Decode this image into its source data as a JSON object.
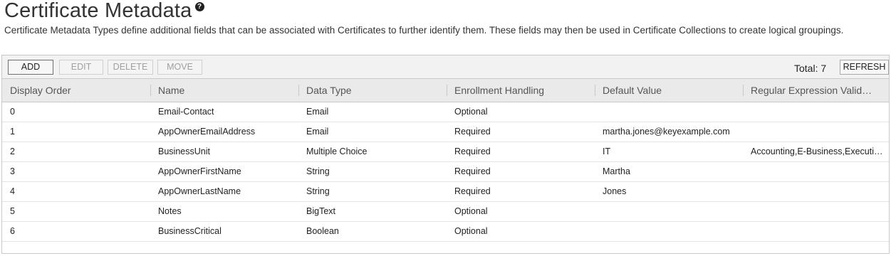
{
  "page": {
    "title": "Certificate Metadata",
    "help_icon": "question-circle-icon",
    "description": "Certificate Metadata Types define additional fields that can be associated with Certificates to further identify them. These fields may then be used in Certificate Collections to create logical groupings."
  },
  "toolbar": {
    "add_label": "ADD",
    "edit_label": "EDIT",
    "delete_label": "DELETE",
    "move_label": "MOVE",
    "total_label": "Total: 7",
    "refresh_label": "REFRESH"
  },
  "table": {
    "columns": [
      "Display Order",
      "Name",
      "Data Type",
      "Enrollment Handling",
      "Default Value",
      "Regular Expression Valid…"
    ],
    "rows": [
      [
        "0",
        "Email-Contact",
        "Email",
        "Optional",
        "",
        ""
      ],
      [
        "1",
        "AppOwnerEmailAddress",
        "Email",
        "Required",
        "martha.jones@keyexample.com",
        ""
      ],
      [
        "2",
        "BusinessUnit",
        "Multiple Choice",
        "Required",
        "IT",
        "Accounting,E-Business,Executi…"
      ],
      [
        "3",
        "AppOwnerFirstName",
        "String",
        "Required",
        "Martha",
        ""
      ],
      [
        "4",
        "AppOwnerLastName",
        "String",
        "Required",
        "Jones",
        ""
      ],
      [
        "5",
        "Notes",
        "BigText",
        "Optional",
        "",
        ""
      ],
      [
        "6",
        "BusinessCritical",
        "Boolean",
        "Optional",
        "",
        ""
      ]
    ]
  }
}
